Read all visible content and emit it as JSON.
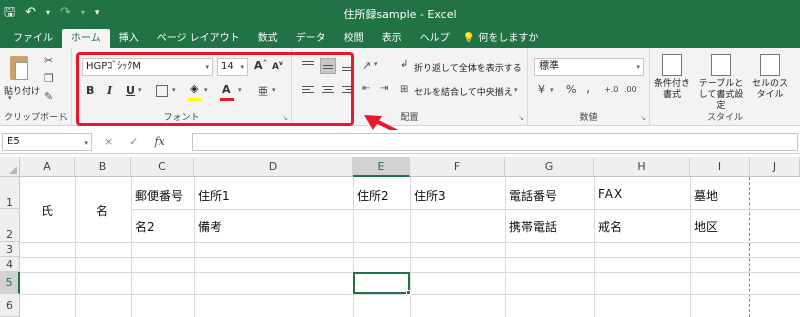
{
  "window": {
    "title": "住所録sample  -  Excel"
  },
  "qat": {
    "save_icon": "save-icon",
    "undo_icon": "undo-icon",
    "redo_icon": "redo-icon",
    "customize_icon": "chevron-down-icon"
  },
  "tabs": [
    {
      "label": "ファイル"
    },
    {
      "label": "ホーム",
      "active": true
    },
    {
      "label": "挿入"
    },
    {
      "label": "ページ レイアウト"
    },
    {
      "label": "数式"
    },
    {
      "label": "データ"
    },
    {
      "label": "校閲"
    },
    {
      "label": "表示"
    },
    {
      "label": "ヘルプ"
    },
    {
      "label": "何をしますか"
    }
  ],
  "ribbon": {
    "clipboard": {
      "paste_label": "貼り付け",
      "group_label": "クリップボード"
    },
    "font": {
      "font_name": "HGPｺﾞｼｯｸM",
      "font_size": "14",
      "grow": "A",
      "shrink": "A",
      "bold": "B",
      "italic": "I",
      "underline": "U",
      "font_color_letter": "A",
      "phonetic": "亜",
      "group_label": "フォント",
      "font_color": "#e8192c",
      "fill_color": "#ffff00"
    },
    "alignment": {
      "wrap_text": "折り返して全体を表示する",
      "merge_center": "セルを結合して中央揃え",
      "group_label": "配置"
    },
    "number": {
      "format": "標準",
      "percent": "%",
      "comma": ",",
      "group_label": "数値"
    },
    "styles": {
      "conditional": "条件付き書式",
      "table": "テーブルとして書式設定",
      "cell_styles": "セルのスタイル",
      "group_label": "スタイル"
    }
  },
  "formula_bar": {
    "name_box": "E5",
    "fx": "fx",
    "cancel": "×",
    "enter": "✓"
  },
  "grid": {
    "columns": [
      "A",
      "B",
      "C",
      "D",
      "E",
      "F",
      "G",
      "H",
      "I",
      "J"
    ],
    "selected_column": "E",
    "rows": [
      "1",
      "2",
      "3",
      "4",
      "5",
      "6"
    ],
    "selected_row": "5",
    "cells": {
      "A1": "氏",
      "B1": "名",
      "C1": "郵便番号",
      "D1": "住所1",
      "E1": "住所2",
      "F1": "住所3",
      "G1": "電話番号",
      "H1": "FAX",
      "I1": "墓地",
      "C2": "名2",
      "D2": "備考",
      "G2": "携帯電話",
      "H2": "戒名",
      "I2": "地区"
    }
  },
  "annotation": {
    "box_color": "#e8192c"
  }
}
